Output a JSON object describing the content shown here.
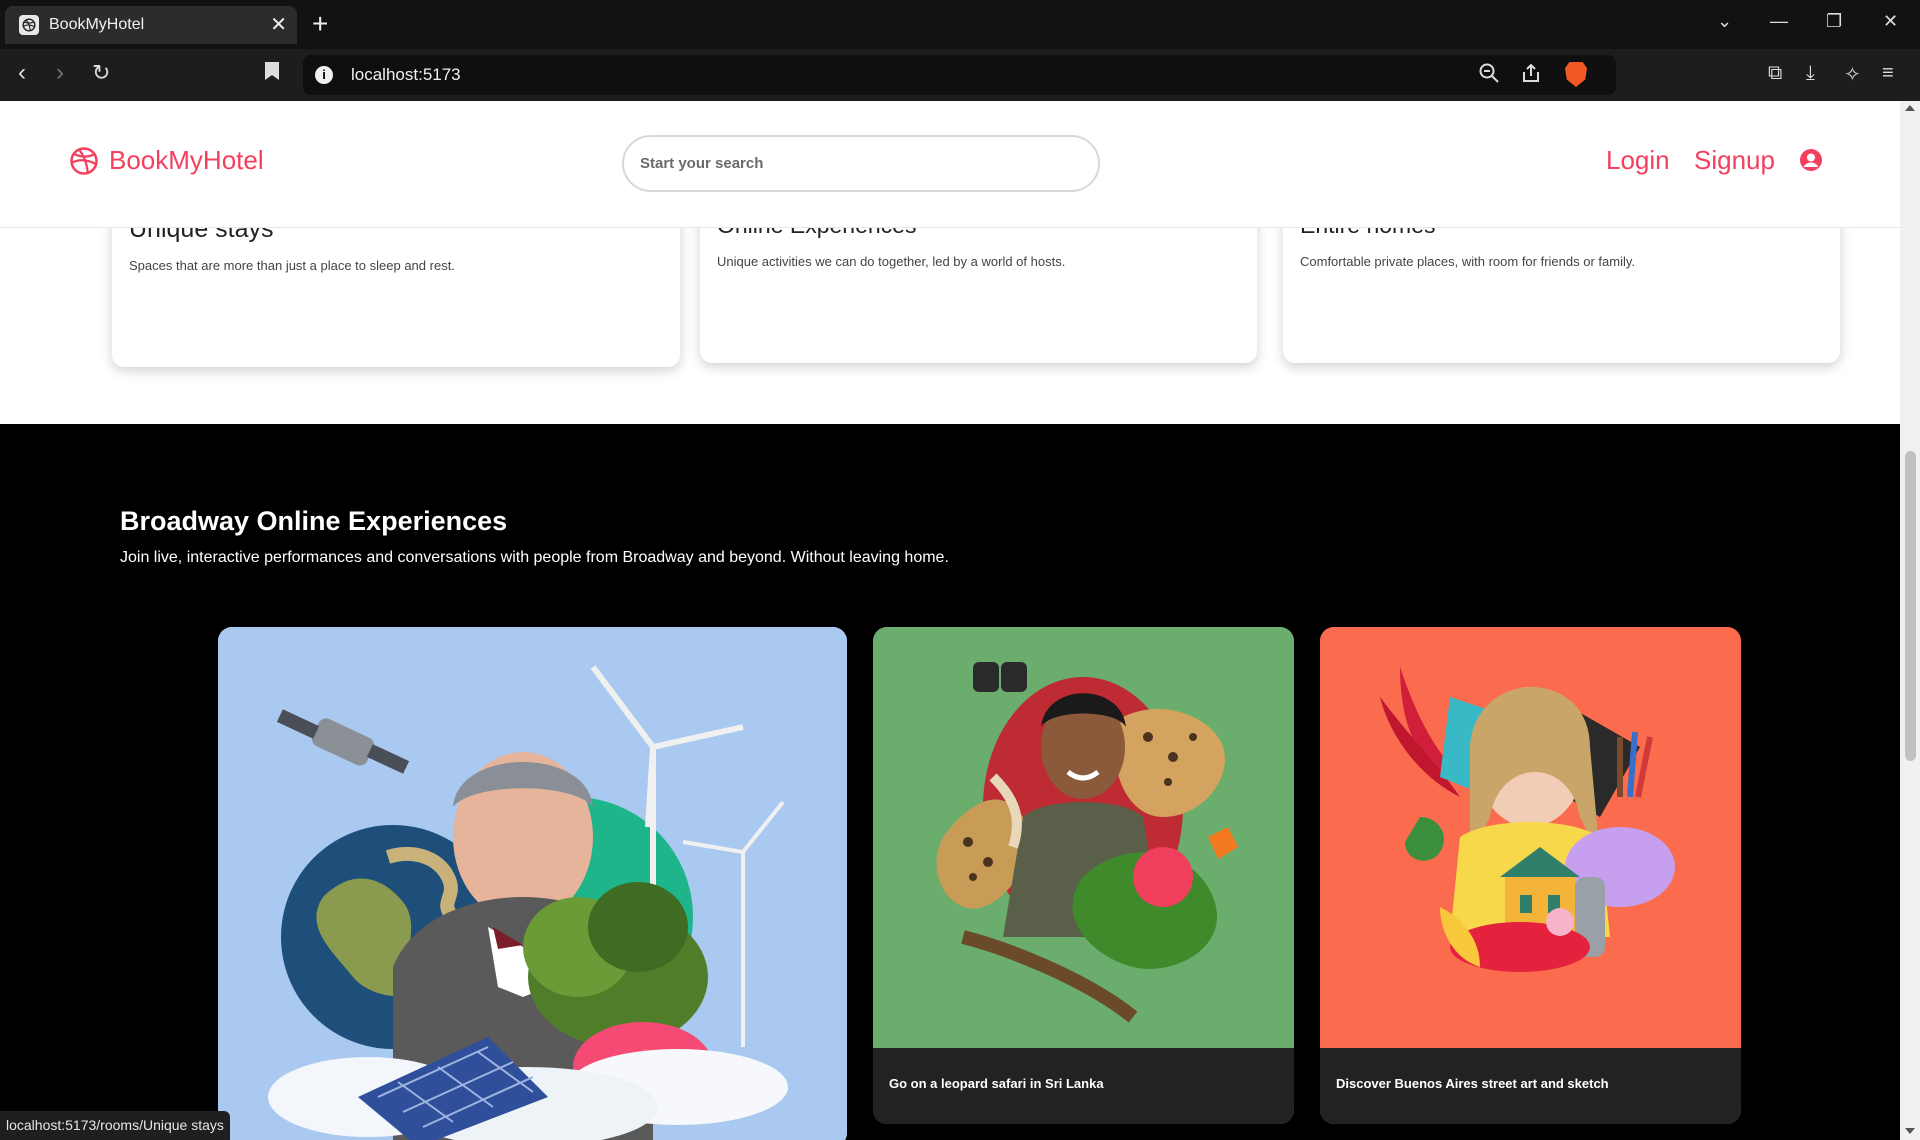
{
  "browser": {
    "tab_title": "BookMyHotel",
    "url": "localhost:5173",
    "status_url": "localhost:5173/rooms/Unique stays"
  },
  "header": {
    "brand": "BookMyHotel",
    "search_placeholder": "Start your search",
    "login": "Login",
    "signup": "Signup"
  },
  "categories": [
    {
      "title": "Unique stays",
      "description": "Spaces that are more than just a place to sleep and rest.",
      "image_color": "#2a2a2a"
    },
    {
      "title": "Online Experiences",
      "description": "Unique activities we can do together, led by a world of hosts.",
      "image_color": "#f6e10a"
    },
    {
      "title": "Entire homes",
      "description": "Comfortable private places, with room for friends or family.",
      "image_color": "#3f6e2a"
    }
  ],
  "broadway": {
    "title": "Broadway Online Experiences",
    "subtitle": "Join live, interactive performances and conversations with people from Broadway and beyond. Without leaving home.",
    "cards": [
      {
        "caption": "",
        "bg": "#a9c9f0"
      },
      {
        "caption": "Go on a leopard safari in Sri Lanka",
        "bg": "#6aad6c"
      },
      {
        "caption": "Discover Buenos Aires street art and sketch",
        "bg": "#fb6b4d"
      }
    ]
  },
  "colors": {
    "brand": "#f43f5e"
  }
}
